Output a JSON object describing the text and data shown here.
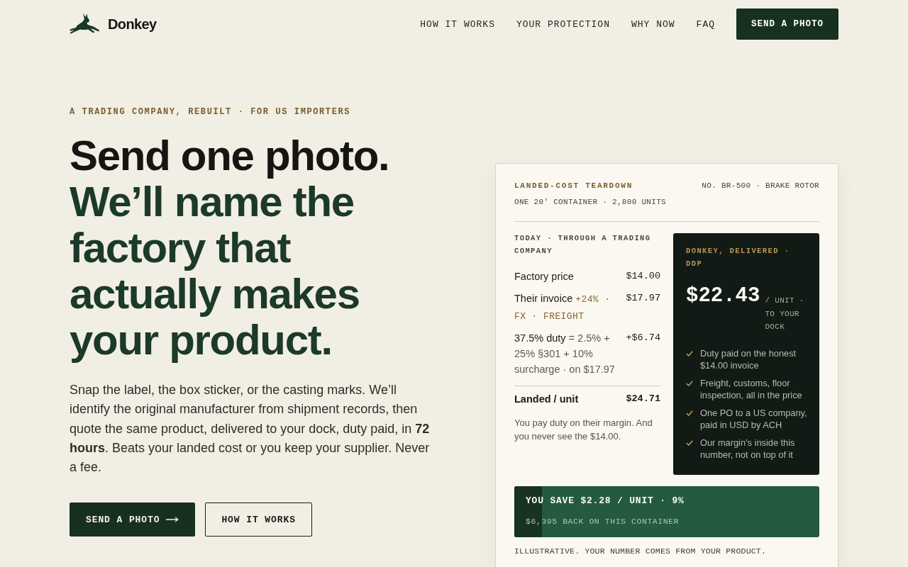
{
  "header": {
    "brand": "Donkey",
    "nav": [
      {
        "label": "HOW IT WORKS"
      },
      {
        "label": "YOUR PROTECTION"
      },
      {
        "label": "WHY NOW"
      },
      {
        "label": "FAQ"
      }
    ],
    "cta": "SEND A PHOTO"
  },
  "hero": {
    "eyebrow": "A TRADING COMPANY, REBUILT · FOR US IMPORTERS",
    "headline": {
      "lead": "Send one photo.",
      "rest": "We’ll name the factory that actually makes your product."
    },
    "body": "Snap the label, the box sticker, or the casting marks. We’ll identify the original manufacturer from shipment records, then quote the same product, delivered to your dock, duty paid, in **72 hours**. Beats your landed cost or you keep your supplier. Never a fee.",
    "buttons": [
      {
        "label": "SEND A PHOTO",
        "kind": "primary",
        "arrow": true
      },
      {
        "label": "HOW IT WORKS",
        "kind": "secondary",
        "arrow": false
      }
    ]
  },
  "card": {
    "title": "LANDED-COST TEARDOWN",
    "reference": "NO. BR-500 · BRAKE ROTOR",
    "subtitle": "ONE 20′ CONTAINER · 2,800 UNITS",
    "today": {
      "heading": "TODAY · THROUGH A TRADING COMPANY",
      "rows": [
        {
          "kind": "plain",
          "label": "Factory price",
          "value": "$14.00"
        },
        {
          "kind": "tag",
          "label": "Their invoice",
          "note": "+24% · FX · FREIGHT",
          "value": "$17.97"
        },
        {
          "kind": "formula",
          "label": "37.5% duty",
          "note": "= 2.5% + 25% §301 + 10% surcharge · on $17.97",
          "value": "+$6.74"
        }
      ],
      "total": {
        "label": "Landed / unit",
        "value": "$24.71"
      },
      "footnote": "You pay duty on their margin. And you never see the $14.00."
    },
    "donkey": {
      "heading": "DONKEY, DELIVERED · DDP",
      "price": "$22.43",
      "unit": "/ UNIT · TO YOUR DOCK",
      "points": [
        "Duty paid on the honest $14.00 invoice",
        "Freight, customs, floor inspection, all in the price",
        "One PO to a US company, paid in USD by ACH",
        "Our margin’s inside this number, not on top of it"
      ]
    },
    "savings": {
      "headline": "YOU SAVE $2.28 / UNIT · 9%",
      "detail": "$6,395 BACK ON THIS CONTAINER",
      "level": 0.09
    },
    "disclaimer": "ILLUSTRATIVE. YOUR NUMBER COMES FROM YOUR PRODUCT."
  }
}
